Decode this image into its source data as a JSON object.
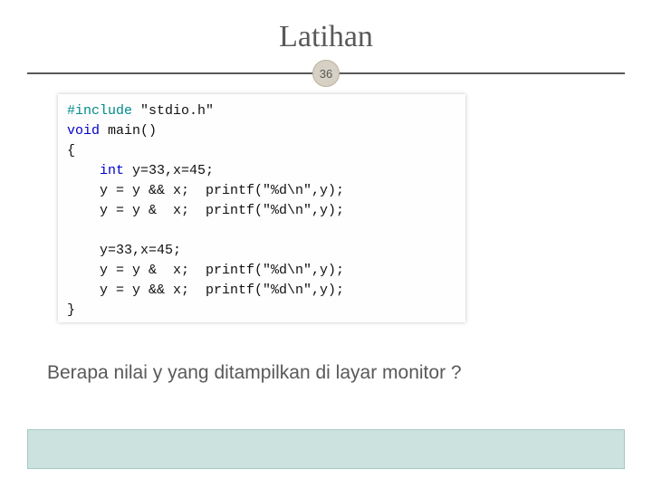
{
  "slide": {
    "title": "Latihan",
    "page_number": "36",
    "question": "Berapa nilai y yang ditampilkan di layar monitor ?"
  },
  "code": {
    "include_kw": "#include",
    "include_arg": " \"stdio.h\"",
    "void_kw": "void",
    "main_sig": " main()",
    "open_brace": "{",
    "indent": "    ",
    "int_kw": "int",
    "decl1_rest": " y=33,x=45;",
    "l2": "y = y && x;  printf(\"%d\\n\",y);",
    "l3": "y = y &  x;  printf(\"%d\\n\",y);",
    "blank": "",
    "l4": "y=33,x=45;",
    "l5": "y = y &  x;  printf(\"%d\\n\",y);",
    "l6": "y = y && x;  printf(\"%d\\n\",y);",
    "close_brace": "}"
  }
}
